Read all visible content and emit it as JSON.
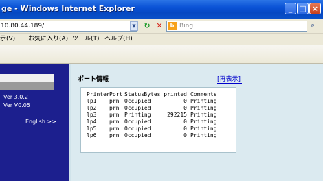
{
  "window": {
    "title": "ge - Windows Internet Explorer"
  },
  "addressbar": {
    "url": "10.80.44.189/",
    "search_placeholder": "Bing",
    "search_logo": "b"
  },
  "menubar": {
    "items": [
      "示(V)",
      "お気に入り(A)",
      "ツール(T)",
      "ヘルプ(H)"
    ]
  },
  "leftnav": {
    "version1": "Ver 3.0.2",
    "version2": "Ver V0.05",
    "language_link": "English >>"
  },
  "main": {
    "section_title": "ポート情報",
    "refresh_label": "[再表示]",
    "table": {
      "headers": [
        "Printer",
        "Port",
        "Status",
        "Bytes printed",
        "Comments"
      ],
      "rows": [
        [
          "lp1",
          "prn",
          "Occupied",
          "0",
          "Printing"
        ],
        [
          "lp2",
          "prn",
          "Occupied",
          "0",
          "Printing"
        ],
        [
          "lp3",
          "prn",
          "Printing",
          "292215",
          "Printing"
        ],
        [
          "lp4",
          "prn",
          "Occupied",
          "0",
          "Printing"
        ],
        [
          "lp5",
          "prn",
          "Occupied",
          "0",
          "Printing"
        ],
        [
          "lp6",
          "prn",
          "Occupied",
          "0",
          "Printing"
        ]
      ]
    }
  },
  "colors": {
    "titlebar": "#0a52d6",
    "leftnav": "#1c1f8e",
    "page_bg": "#dbeaf0",
    "link": "#0000cc"
  }
}
